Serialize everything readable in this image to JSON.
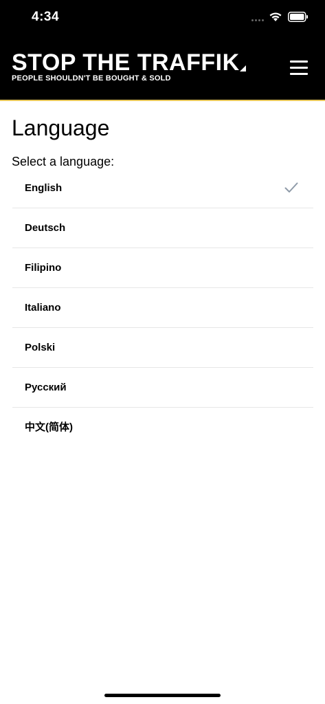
{
  "status_bar": {
    "time": "4:34"
  },
  "header": {
    "brand_title": "STOP THE TRAFFIK",
    "brand_tagline": "PEOPLE SHOULDN'T BE BOUGHT & SOLD",
    "brand_mark_icon": "triangle-mark-icon",
    "menu_icon": "hamburger-menu-icon",
    "accent_color": "#e8c75a"
  },
  "main": {
    "title": "Language",
    "subtitle": "Select a language:",
    "selected_icon": "checkmark-icon",
    "languages": [
      {
        "label": "English",
        "selected": true
      },
      {
        "label": "Deutsch",
        "selected": false
      },
      {
        "label": "Filipino",
        "selected": false
      },
      {
        "label": "Italiano",
        "selected": false
      },
      {
        "label": "Polski",
        "selected": false
      },
      {
        "label": "Русский",
        "selected": false
      },
      {
        "label": "中文(简体)",
        "selected": false
      }
    ]
  }
}
